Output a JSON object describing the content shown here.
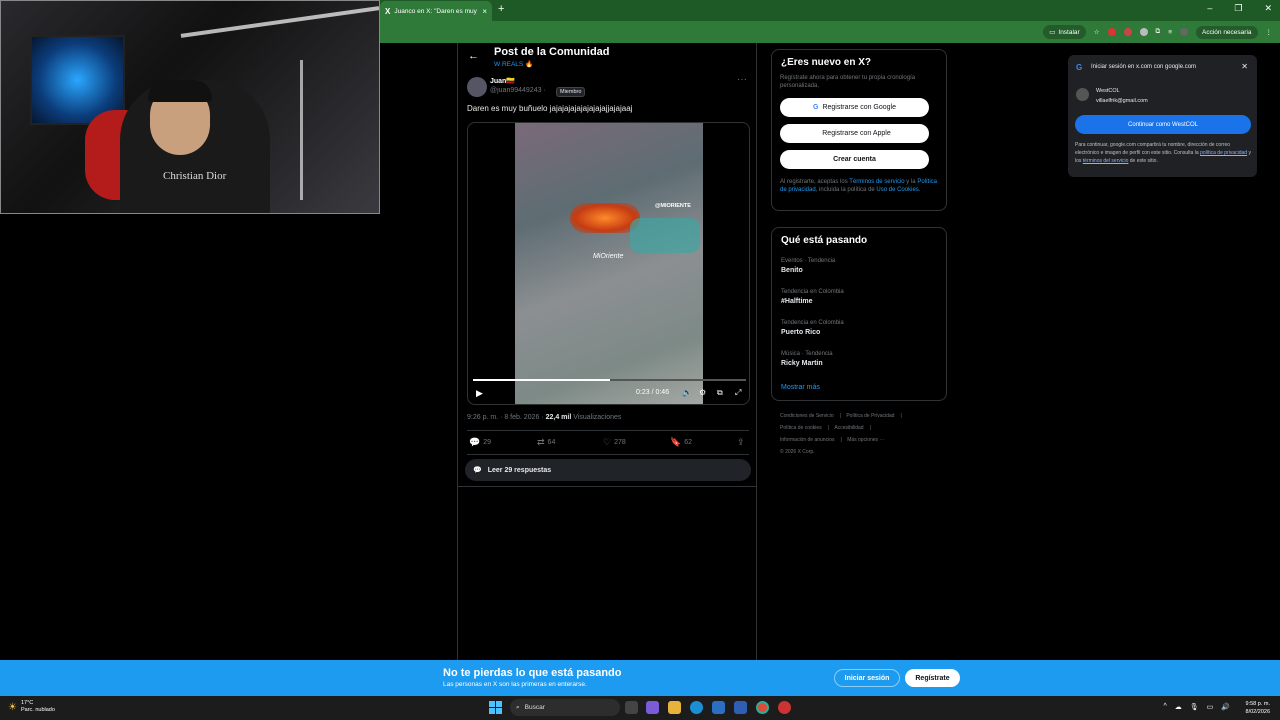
{
  "browser": {
    "tab_favicon": "X",
    "tab_title": "Juanco en X: \"Daren es muy bu",
    "tab_close": "×",
    "new_tab": "+",
    "install_label": "Instalar",
    "action_needed": "Acción necesaria",
    "window_controls": [
      "–",
      "❐",
      "✕"
    ]
  },
  "post_header": {
    "back": "←",
    "title": "Post de la Comunidad",
    "subtitle": "W REALS 🔥"
  },
  "tweet": {
    "author": "Juan🇨🇴",
    "handle": "@juan99449243 ·",
    "member_badge": "Miembro",
    "more": "···",
    "text": "Daren es muy buñuelo jajajajajajajajajajjajajaaj",
    "video_watermark_top": "@MIORIENTE",
    "video_watermark_mid": "MiOriente",
    "video_time": "0:23 / 0:46",
    "video_progress": 0.5,
    "timestamp": "9:26 p. m. · 8 feb. 2026 ·",
    "views_count": "22,4 mil",
    "views_label": "Visualizaciones",
    "replies": "29",
    "reposts": "64",
    "likes": "278",
    "bookmarks": "62",
    "read_replies": "Leer 29 respuestas"
  },
  "signup_card": {
    "title": "¿Eres nuevo en X?",
    "description": "Regístrate ahora para obtener tu propia cronología personalizada.",
    "google_button": "Registrarse con Google",
    "apple_button": "Registrarse con Apple",
    "create_button": "Crear cuenta",
    "legal_prefix": "Al registrarte, aceptas los",
    "terms_link": "Términos de servicio",
    "legal_and": "y la",
    "privacy_link": "Política de privacidad",
    "legal_including": ", incluida la política de",
    "cookies_link": "Uso de Cookies."
  },
  "trends": {
    "title": "Qué está pasando",
    "items": [
      {
        "category": "Eventos · Tendencia",
        "name": "Benito"
      },
      {
        "category": "Tendencia en Colombia",
        "name": "#Halftime"
      },
      {
        "category": "Tendencia en Colombia",
        "name": "Puerto Rico"
      },
      {
        "category": "Música · Tendencia",
        "name": "Ricky Martin"
      }
    ],
    "show_more": "Mostrar más"
  },
  "footer": {
    "links": [
      "Condiciones de Servicio",
      "Política de Privacidad",
      "Política de cookies",
      "Accesibilidad",
      "Información de anuncios",
      "Más opciones ···"
    ],
    "copyright": "© 2026 X Corp."
  },
  "google_popup": {
    "logo": "G",
    "title": "Iniciar sesión en x.com con google.com",
    "close": "✕",
    "account_name": "WestCOL",
    "account_email": "villaelfrik@gmail.com",
    "continue_button": "Continuar como WestCOL",
    "fine_print_1": "Para continuar, google.com compartirá tu nombre, dirección de correo electrónico e imagen de perfil con este sitio. Consulta la",
    "privacy_link": "política de privacidad",
    "fine_print_2": "y los",
    "terms_link": "términos del servicio",
    "fine_print_3": "de este sitio."
  },
  "banner": {
    "title": "No te pierdas lo que está pasando",
    "subtitle": "Las personas en X son las primeras en enterarse.",
    "login": "Iniciar sesión",
    "register": "Regístrate"
  },
  "taskbar": {
    "weather_temp": "17°C",
    "weather_desc": "Parc. nublado",
    "search_placeholder": "Buscar",
    "time": "9:58 p. m.",
    "date": "8/02/2026"
  },
  "webcam": {
    "shirt_text": "Christian Dior"
  }
}
